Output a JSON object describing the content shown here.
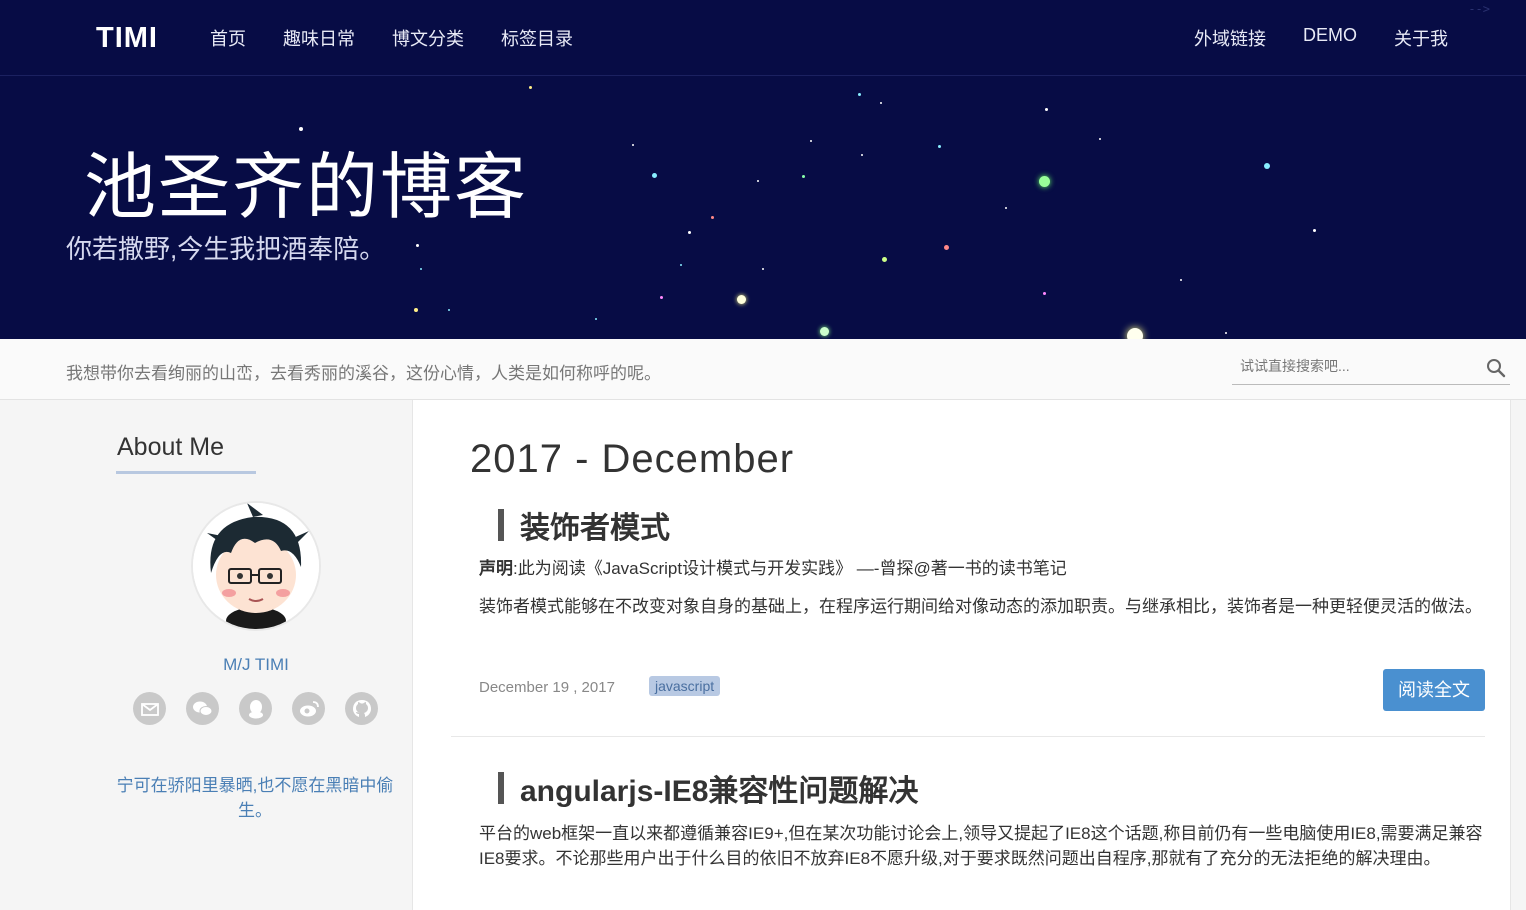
{
  "nav": {
    "logo": "TIMI",
    "left_items": [
      "首页",
      "趣味日常",
      "博文分类",
      "标签目录"
    ],
    "right_items": [
      "外域链接",
      "DEMO",
      "关于我"
    ],
    "comment": "-->"
  },
  "hero": {
    "title": "池圣齐的博客",
    "subtitle": "你若撒野,今生我把酒奉陪。"
  },
  "bar": {
    "motto": "我想带你去看绚丽的山峦，去看秀丽的溪谷，这份心情，人类是如何称呼的呢。",
    "search_placeholder": "试试直接搜索吧..."
  },
  "sidebar": {
    "about_title": "About Me",
    "author": "M/J TIMI",
    "social_icons": [
      "mail-icon",
      "wechat-icon",
      "qq-icon",
      "weibo-icon",
      "github-icon"
    ],
    "quote": "宁可在骄阳里暴晒,也不愿在黑暗中偷生。"
  },
  "main": {
    "month": "2017 - December",
    "posts": [
      {
        "title": "装饰者模式",
        "statement_label": "声明",
        "statement_text": ":此为阅读《JavaScript设计模式与开发实践》 —-曾探@著一书的读书笔记",
        "excerpt": "装饰者模式能够在不改变对象自身的基础上，在程序运行期间给对像动态的添加职责。与继承相比，装饰者是一种更轻便灵活的做法。",
        "date": "December 19 , 2017",
        "tag": "javascript",
        "read_more": "阅读全文"
      },
      {
        "title": "angularjs-IE8兼容性问题解决",
        "excerpt": "平台的web框架一直以来都遵循兼容IE9+,但在某次功能讨论会上,领导又提起了IE8这个话题,称目前仍有一些电脑使用IE8,需要满足兼容IE8要求。不论那些用户出于什么目的依旧不放弃IE8不愿升级,对于要求既然问题出自程序,那就有了充分的无法拒绝的解决理由。"
      }
    ]
  },
  "colors": {
    "header_bg": "#070c45",
    "accent": "#4a90d0",
    "link": "#4a7fb5"
  }
}
